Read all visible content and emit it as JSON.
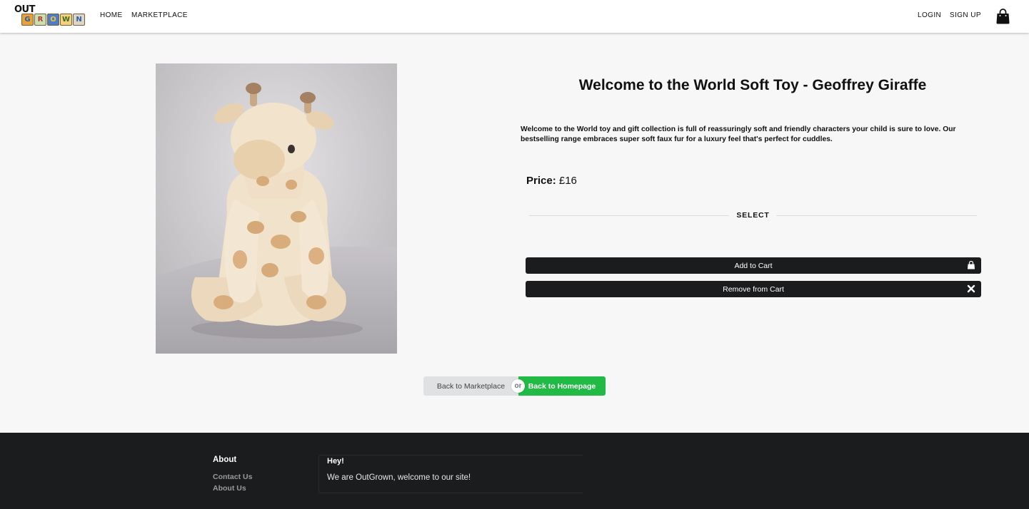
{
  "navbar": {
    "logo": {
      "top_text": "OUT",
      "blocks": [
        {
          "letter": "G",
          "bg": "#e5a23a",
          "color": "#2c5fa8"
        },
        {
          "letter": "R",
          "bg": "#c9e0b1",
          "color": "#b63a2b"
        },
        {
          "letter": "O",
          "bg": "#4b7fc2",
          "color": "#f0c040"
        },
        {
          "letter": "W",
          "bg": "#f2d27a",
          "color": "#3a6b2a"
        },
        {
          "letter": "N",
          "bg": "#dcd6c6",
          "color": "#2c5fa8"
        }
      ]
    },
    "links": [
      "HOME",
      "MARKETPLACE"
    ],
    "right_links": [
      "LOGIN",
      "SIGN UP"
    ],
    "cart_icon": "shopping-bag-icon"
  },
  "product": {
    "image_alt": "Geoffrey Giraffe soft toy",
    "title": "Welcome to the World Soft Toy - Geoffrey Giraffe",
    "description": "Welcome to the World toy and gift collection is full of reassuringly soft and friendly characters your child is sure to love. Our bestselling range embraces super soft faux fur for a luxury feel that's perfect for cuddles.",
    "price_label": "Price:",
    "price_value": "£16",
    "select_label": "SELECT",
    "add_to_cart": "Add to Cart",
    "add_to_cart_icon": "shopping-bag-icon",
    "remove_from_cart": "Remove from Cart",
    "remove_from_cart_icon": "close-icon"
  },
  "back_buttons": {
    "marketplace": "Back to Marketplace",
    "or": "or",
    "homepage": "Back to Homepage"
  },
  "footer": {
    "about_heading": "About",
    "links": [
      "Contact Us",
      "About Us"
    ],
    "message_heading": "Hey!",
    "message_text": "We are OutGrown, welcome to our site!"
  },
  "colors": {
    "accent_green": "#21ba45",
    "dark": "#1b1c1d",
    "page_bg": "#f7f7f7"
  }
}
